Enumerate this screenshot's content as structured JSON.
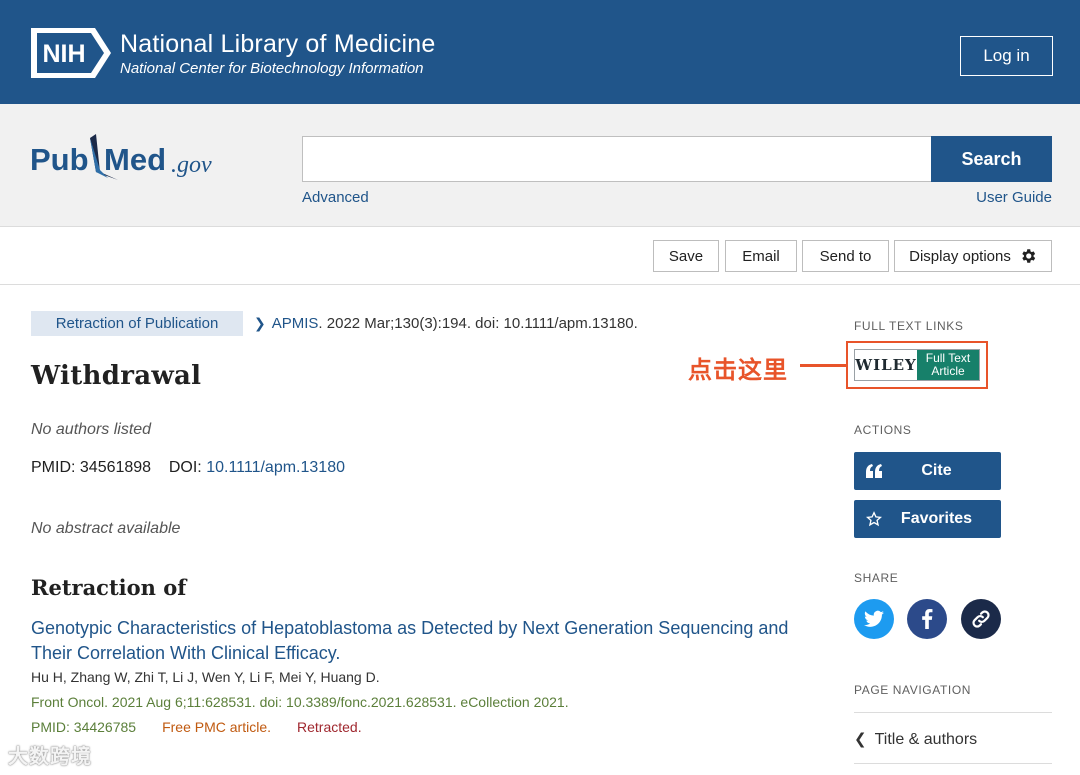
{
  "header": {
    "nih_abbrev": "NIH",
    "title": "National Library of Medicine",
    "subtitle": "National Center for Biotechnology Information",
    "login_label": "Log in"
  },
  "search": {
    "logo_pub": "Pub",
    "logo_med": "Med",
    "logo_gov": ".gov",
    "value": "",
    "button_label": "Search",
    "advanced_label": "Advanced",
    "user_guide_label": "User Guide"
  },
  "toolbar": {
    "save_label": "Save",
    "email_label": "Email",
    "send_to_label": "Send to",
    "display_options_label": "Display options"
  },
  "article": {
    "tag": "Retraction of Publication",
    "journal": "APMIS",
    "citation_rest": ". 2022 Mar;130(3):194. doi: 10.1111/apm.13180.",
    "title": "Withdrawal",
    "authors": "No authors listed",
    "pmid_text": "PMID: 34561898",
    "doi_label": "DOI:",
    "doi_value": "10.1111/apm.13180",
    "abstract": "No abstract available"
  },
  "retraction_of": {
    "heading": "Retraction of",
    "title": "Genotypic Characteristics of Hepatoblastoma as Detected by Next Generation Sequencing and Their Correlation With Clinical Efficacy.",
    "authors": "Hu H, Zhang W, Zhi T, Li J, Wen Y, Li F, Mei Y, Huang D.",
    "citation": "Front Oncol. 2021 Aug 6;11:628531. doi: 10.3389/fonc.2021.628531. eCollection 2021.",
    "pmid": "PMID: 34426785",
    "free_pmc": "Free PMC article.",
    "retracted": "Retracted."
  },
  "sidebar": {
    "full_text_links_label": "FULL TEXT LINKS",
    "wiley_word": "WILEY",
    "wiley_full_text": "Full Text",
    "wiley_article": "Article",
    "annotation": "点击这里",
    "actions_label": "ACTIONS",
    "cite_label": "Cite",
    "favorites_label": "Favorites",
    "share_label": "SHARE",
    "page_navigation_label": "PAGE NAVIGATION",
    "nav_title_authors": "Title & authors"
  },
  "colors": {
    "brand_blue": "#20558a",
    "annotation_orange": "#e8542a",
    "wiley_green": "#17806a",
    "twitter": "#1d9bf0",
    "facebook": "#2c4a8a",
    "link_share": "#1b2a49"
  },
  "watermark": "大数跨境"
}
